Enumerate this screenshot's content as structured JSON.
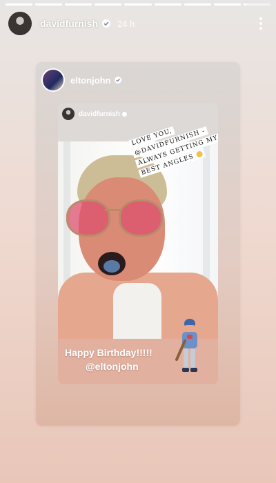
{
  "progress": {
    "segments": [
      1,
      1,
      1,
      1,
      1,
      1,
      1,
      1,
      0.1
    ]
  },
  "story": {
    "username": "davidfurnish",
    "time": "24 h"
  },
  "reshare": {
    "account": "eltonjohn",
    "inner_account": "davidfurnish",
    "note_lines": [
      "LOVE YOU,",
      "@DAVIDFURNISH -",
      "ALWAYS GETTING MY",
      "BEST ANGLES"
    ],
    "caption_line1": "Happy Birthday!!!!!",
    "caption_line2": "@eltonjohn"
  }
}
